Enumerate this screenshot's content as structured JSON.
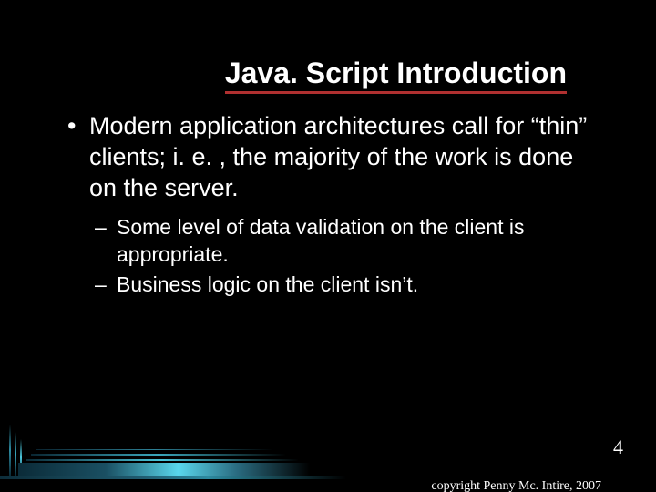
{
  "title": "Java. Script Introduction",
  "bullets": {
    "l1": "Modern application architectures call for “thin” clients; i. e. , the majority of the work is done on the server.",
    "l2a": "Some level of data validation on the client is appropriate.",
    "l2b": "Business logic on the client isn’t."
  },
  "slide_number": "4",
  "copyright": "copyright Penny Mc. Intire, 2007"
}
